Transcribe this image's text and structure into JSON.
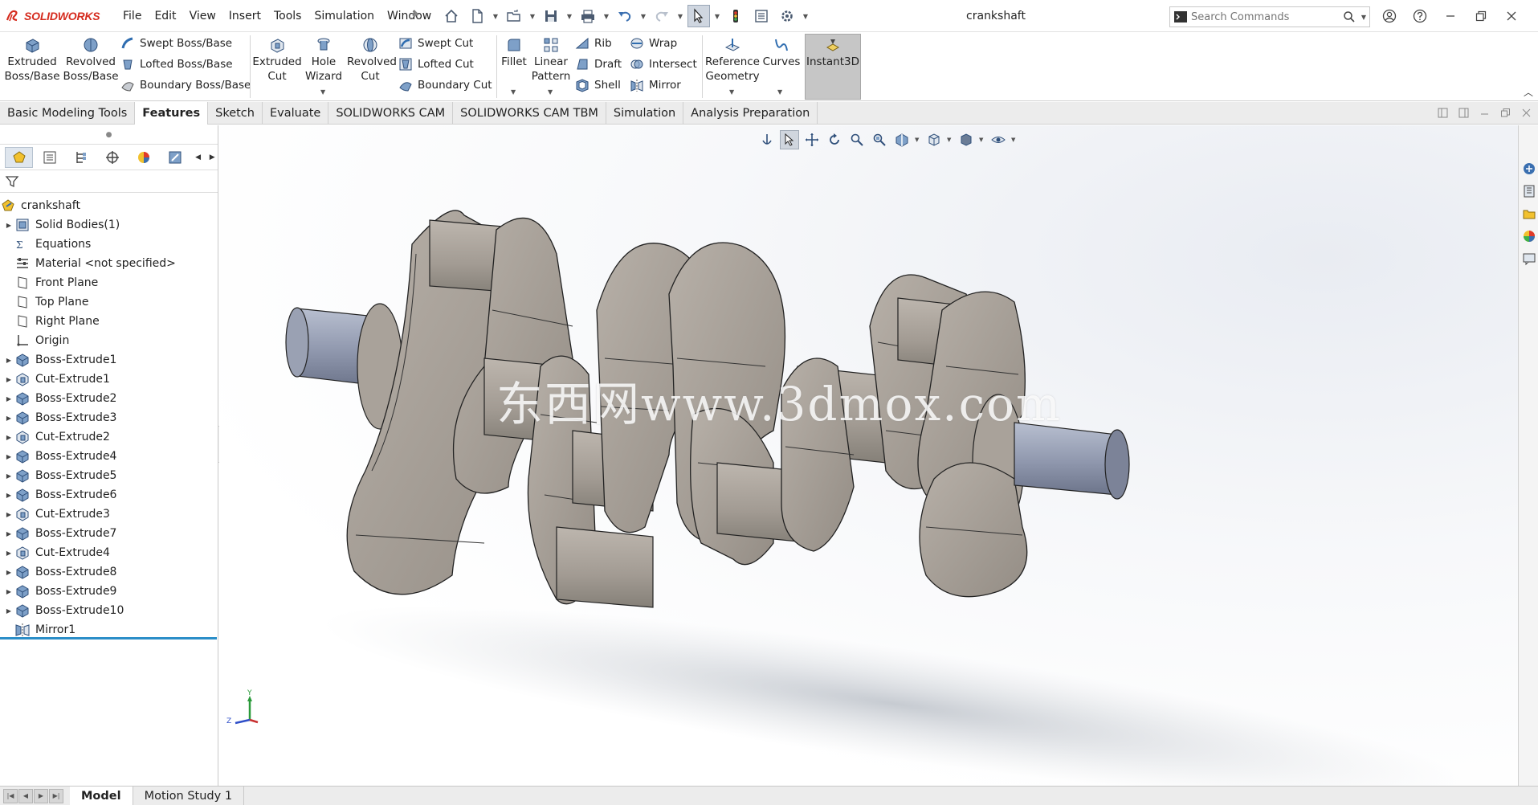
{
  "app": {
    "logo_text": "SOLIDWORKS",
    "document_title": "crankshaft",
    "brand_color": "#d52b1e"
  },
  "menu": [
    "File",
    "Edit",
    "View",
    "Insert",
    "Tools",
    "Simulation",
    "Window"
  ],
  "quick_access_icons": [
    "home-icon",
    "new-document-icon",
    "open-icon",
    "save-icon",
    "print-icon",
    "undo-icon",
    "redo-icon",
    "select-icon",
    "rebuild-icon",
    "file-properties-icon",
    "options-icon"
  ],
  "search": {
    "placeholder": "Search Commands"
  },
  "ribbon": {
    "extruded_boss": [
      "Extruded",
      "Boss/Base"
    ],
    "revolved_boss": [
      "Revolved",
      "Boss/Base"
    ],
    "swept_boss": "Swept Boss/Base",
    "lofted_boss": "Lofted Boss/Base",
    "boundary_boss": "Boundary Boss/Base",
    "extruded_cut": [
      "Extruded",
      "Cut"
    ],
    "hole_wizard": [
      "Hole",
      "Wizard"
    ],
    "revolved_cut": [
      "Revolved",
      "Cut"
    ],
    "swept_cut": "Swept Cut",
    "lofted_cut": "Lofted Cut",
    "boundary_cut": "Boundary Cut",
    "fillet": "Fillet",
    "linear_pattern": [
      "Linear",
      "Pattern"
    ],
    "rib": "Rib",
    "draft": "Draft",
    "shell": "Shell",
    "wrap": "Wrap",
    "intersect": "Intersect",
    "mirror": "Mirror",
    "reference_geometry": [
      "Reference",
      "Geometry"
    ],
    "curves": "Curves",
    "instant3d": "Instant3D"
  },
  "tabs": [
    {
      "label": "Basic Modeling Tools",
      "active": false
    },
    {
      "label": "Features",
      "active": true
    },
    {
      "label": "Sketch",
      "active": false
    },
    {
      "label": "Evaluate",
      "active": false
    },
    {
      "label": "SOLIDWORKS CAM",
      "active": false
    },
    {
      "label": "SOLIDWORKS CAM TBM",
      "active": false
    },
    {
      "label": "Simulation",
      "active": false
    },
    {
      "label": "Analysis Preparation",
      "active": false
    }
  ],
  "feature_tree": [
    {
      "label": "crankshaft",
      "icon": "part-icon",
      "expandable": false,
      "root": true
    },
    {
      "label": "Solid Bodies(1)",
      "icon": "solid-bodies-icon",
      "expandable": true
    },
    {
      "label": "Equations",
      "icon": "equations-icon",
      "expandable": false
    },
    {
      "label": "Material <not specified>",
      "icon": "material-icon",
      "expandable": false
    },
    {
      "label": "Front Plane",
      "icon": "plane-icon",
      "expandable": false
    },
    {
      "label": "Top Plane",
      "icon": "plane-icon",
      "expandable": false
    },
    {
      "label": "Right Plane",
      "icon": "plane-icon",
      "expandable": false
    },
    {
      "label": "Origin",
      "icon": "origin-icon",
      "expandable": false
    },
    {
      "label": "Boss-Extrude1",
      "icon": "boss-extrude-icon",
      "expandable": true
    },
    {
      "label": "Cut-Extrude1",
      "icon": "cut-extrude-icon",
      "expandable": true
    },
    {
      "label": "Boss-Extrude2",
      "icon": "boss-extrude-icon",
      "expandable": true
    },
    {
      "label": "Boss-Extrude3",
      "icon": "boss-extrude-icon",
      "expandable": true
    },
    {
      "label": "Cut-Extrude2",
      "icon": "cut-extrude-icon",
      "expandable": true
    },
    {
      "label": "Boss-Extrude4",
      "icon": "boss-extrude-icon",
      "expandable": true
    },
    {
      "label": "Boss-Extrude5",
      "icon": "boss-extrude-icon",
      "expandable": true
    },
    {
      "label": "Boss-Extrude6",
      "icon": "boss-extrude-icon",
      "expandable": true
    },
    {
      "label": "Cut-Extrude3",
      "icon": "cut-extrude-icon",
      "expandable": true
    },
    {
      "label": "Boss-Extrude7",
      "icon": "boss-extrude-icon",
      "expandable": true
    },
    {
      "label": "Cut-Extrude4",
      "icon": "cut-extrude-icon",
      "expandable": true
    },
    {
      "label": "Boss-Extrude8",
      "icon": "boss-extrude-icon",
      "expandable": true
    },
    {
      "label": "Boss-Extrude9",
      "icon": "boss-extrude-icon",
      "expandable": true
    },
    {
      "label": "Boss-Extrude10",
      "icon": "boss-extrude-icon",
      "expandable": true
    },
    {
      "label": "Mirror1",
      "icon": "mirror-icon",
      "expandable": false
    }
  ],
  "viewport": {
    "watermark": "东西网www.3dmox.com",
    "triad": {
      "y": "Y",
      "z": "Z"
    }
  },
  "bottom_tabs": [
    {
      "label": "Model",
      "active": true
    },
    {
      "label": "Motion Study 1",
      "active": false
    }
  ]
}
